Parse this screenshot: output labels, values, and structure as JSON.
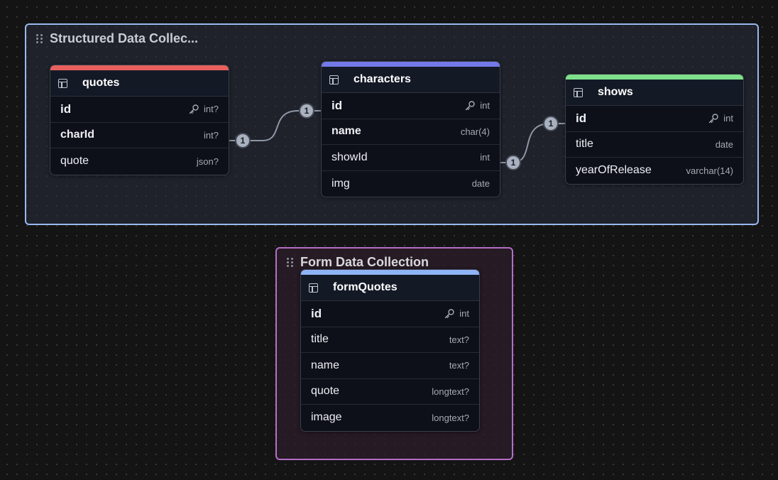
{
  "groups": {
    "structured": {
      "title": "Structured Data Collec..."
    },
    "form": {
      "title": "Form Data Collection"
    }
  },
  "tables": {
    "quotes": {
      "name": "quotes",
      "color": "#e8605c",
      "columns": [
        {
          "name": "id",
          "type": "int?"
        },
        {
          "name": "charId",
          "type": "int?"
        },
        {
          "name": "quote",
          "type": "json?"
        }
      ]
    },
    "characters": {
      "name": "characters",
      "color": "#7479e8",
      "columns": [
        {
          "name": "id",
          "type": "int"
        },
        {
          "name": "name",
          "type": "char(4)"
        },
        {
          "name": "showId",
          "type": "int"
        },
        {
          "name": "img",
          "type": "date"
        }
      ]
    },
    "shows": {
      "name": "shows",
      "color": "#7ee08a",
      "columns": [
        {
          "name": "id",
          "type": "int"
        },
        {
          "name": "title",
          "type": "date"
        },
        {
          "name": "yearOfRelease",
          "type": "varchar(14)"
        }
      ]
    },
    "formQuotes": {
      "name": "formQuotes",
      "color": "#8fb4f5",
      "columns": [
        {
          "name": "id",
          "type": "int"
        },
        {
          "name": "title",
          "type": "text?"
        },
        {
          "name": "name",
          "type": "text?"
        },
        {
          "name": "quote",
          "type": "longtext?"
        },
        {
          "name": "image",
          "type": "longtext?"
        }
      ]
    }
  },
  "relations": {
    "quotes_characters": {
      "from_label": "1",
      "to_label": "1"
    },
    "characters_shows": {
      "from_label": "1",
      "to_label": "1"
    }
  }
}
